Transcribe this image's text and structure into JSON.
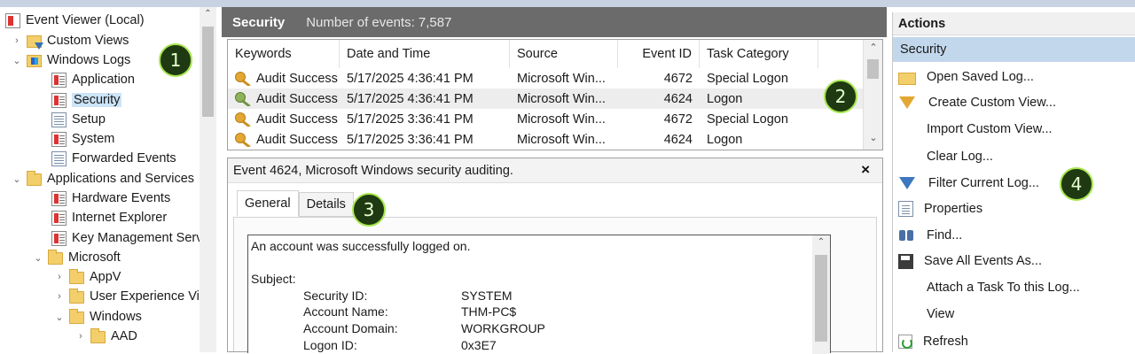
{
  "tree": {
    "items": [
      {
        "label": "Event Viewer (Local)",
        "icon": "event-viewer-icon"
      },
      {
        "label": "Custom Views",
        "icon": "filter-folder-icon"
      },
      {
        "label": "Windows Logs",
        "icon": "windows-logs-icon"
      },
      {
        "label": "Application",
        "icon": "log-icon"
      },
      {
        "label": "Security",
        "icon": "log-icon",
        "selected": true
      },
      {
        "label": "Setup",
        "icon": "log-plain-icon"
      },
      {
        "label": "System",
        "icon": "log-icon"
      },
      {
        "label": "Forwarded Events",
        "icon": "log-plain-icon"
      },
      {
        "label": "Applications and Services",
        "icon": "folder-icon"
      },
      {
        "label": "Hardware Events",
        "icon": "log-icon"
      },
      {
        "label": "Internet Explorer",
        "icon": "log-icon"
      },
      {
        "label": "Key Management Serv",
        "icon": "log-icon"
      },
      {
        "label": "Microsoft",
        "icon": "folder-icon"
      },
      {
        "label": "AppV",
        "icon": "folder-icon"
      },
      {
        "label": "User Experience Vi",
        "icon": "folder-icon"
      },
      {
        "label": "Windows",
        "icon": "folder-icon"
      },
      {
        "label": "AAD",
        "icon": "folder-icon"
      }
    ]
  },
  "center": {
    "title": "Security",
    "count_text": "Number of events: 7,587"
  },
  "events": {
    "columns": [
      "Keywords",
      "Date and Time",
      "Source",
      "Event ID",
      "Task Category"
    ],
    "rows": [
      {
        "keywords": "Audit Success",
        "datetime": "5/17/2025 4:36:41 PM",
        "source": "Microsoft Win...",
        "event_id": "4672",
        "task": "Special Logon"
      },
      {
        "keywords": "Audit Success",
        "datetime": "5/17/2025 4:36:41 PM",
        "source": "Microsoft Win...",
        "event_id": "4624",
        "task": "Logon",
        "selected": true
      },
      {
        "keywords": "Audit Success",
        "datetime": "5/17/2025 3:36:41 PM",
        "source": "Microsoft Win...",
        "event_id": "4672",
        "task": "Special Logon"
      },
      {
        "keywords": "Audit Success",
        "datetime": "5/17/2025 3:36:41 PM",
        "source": "Microsoft Win...",
        "event_id": "4624",
        "task": "Logon"
      }
    ]
  },
  "detail": {
    "title": "Event 4624, Microsoft Windows security auditing.",
    "close": "×",
    "tabs": [
      "General",
      "Details"
    ],
    "summary": "An account was successfully logged on.",
    "subject_heading": "Subject:",
    "fields": [
      {
        "label": "Security ID:",
        "value": "SYSTEM"
      },
      {
        "label": "Account Name:",
        "value": "THM-PC$"
      },
      {
        "label": "Account Domain:",
        "value": "WORKGROUP"
      },
      {
        "label": "Logon ID:",
        "value": "0x3E7"
      }
    ]
  },
  "actions": {
    "title": "Actions",
    "section": "Security",
    "items": [
      {
        "label": "Open Saved Log...",
        "icon": "open-folder-icon"
      },
      {
        "label": "Create Custom View...",
        "icon": "filter-icon"
      },
      {
        "label": "Import Custom View...",
        "icon": ""
      },
      {
        "label": "Clear Log...",
        "icon": ""
      },
      {
        "label": "Filter Current Log...",
        "icon": "filter-icon"
      },
      {
        "label": "Properties",
        "icon": "properties-icon"
      },
      {
        "label": "Find...",
        "icon": "binoculars-icon"
      },
      {
        "label": "Save All Events As...",
        "icon": "save-icon"
      },
      {
        "label": "Attach a Task To this Log...",
        "icon": ""
      },
      {
        "label": "View",
        "icon": ""
      },
      {
        "label": "Refresh",
        "icon": "refresh-icon"
      }
    ]
  },
  "callouts": [
    "1",
    "2",
    "3",
    "4"
  ],
  "colors": {
    "callout_fill": "#1f3a12",
    "callout_ring": "#a8e64d",
    "selection": "#cce4f7",
    "header_bg": "#6b6b6b",
    "actions_section_bg": "#c3d7ec"
  }
}
